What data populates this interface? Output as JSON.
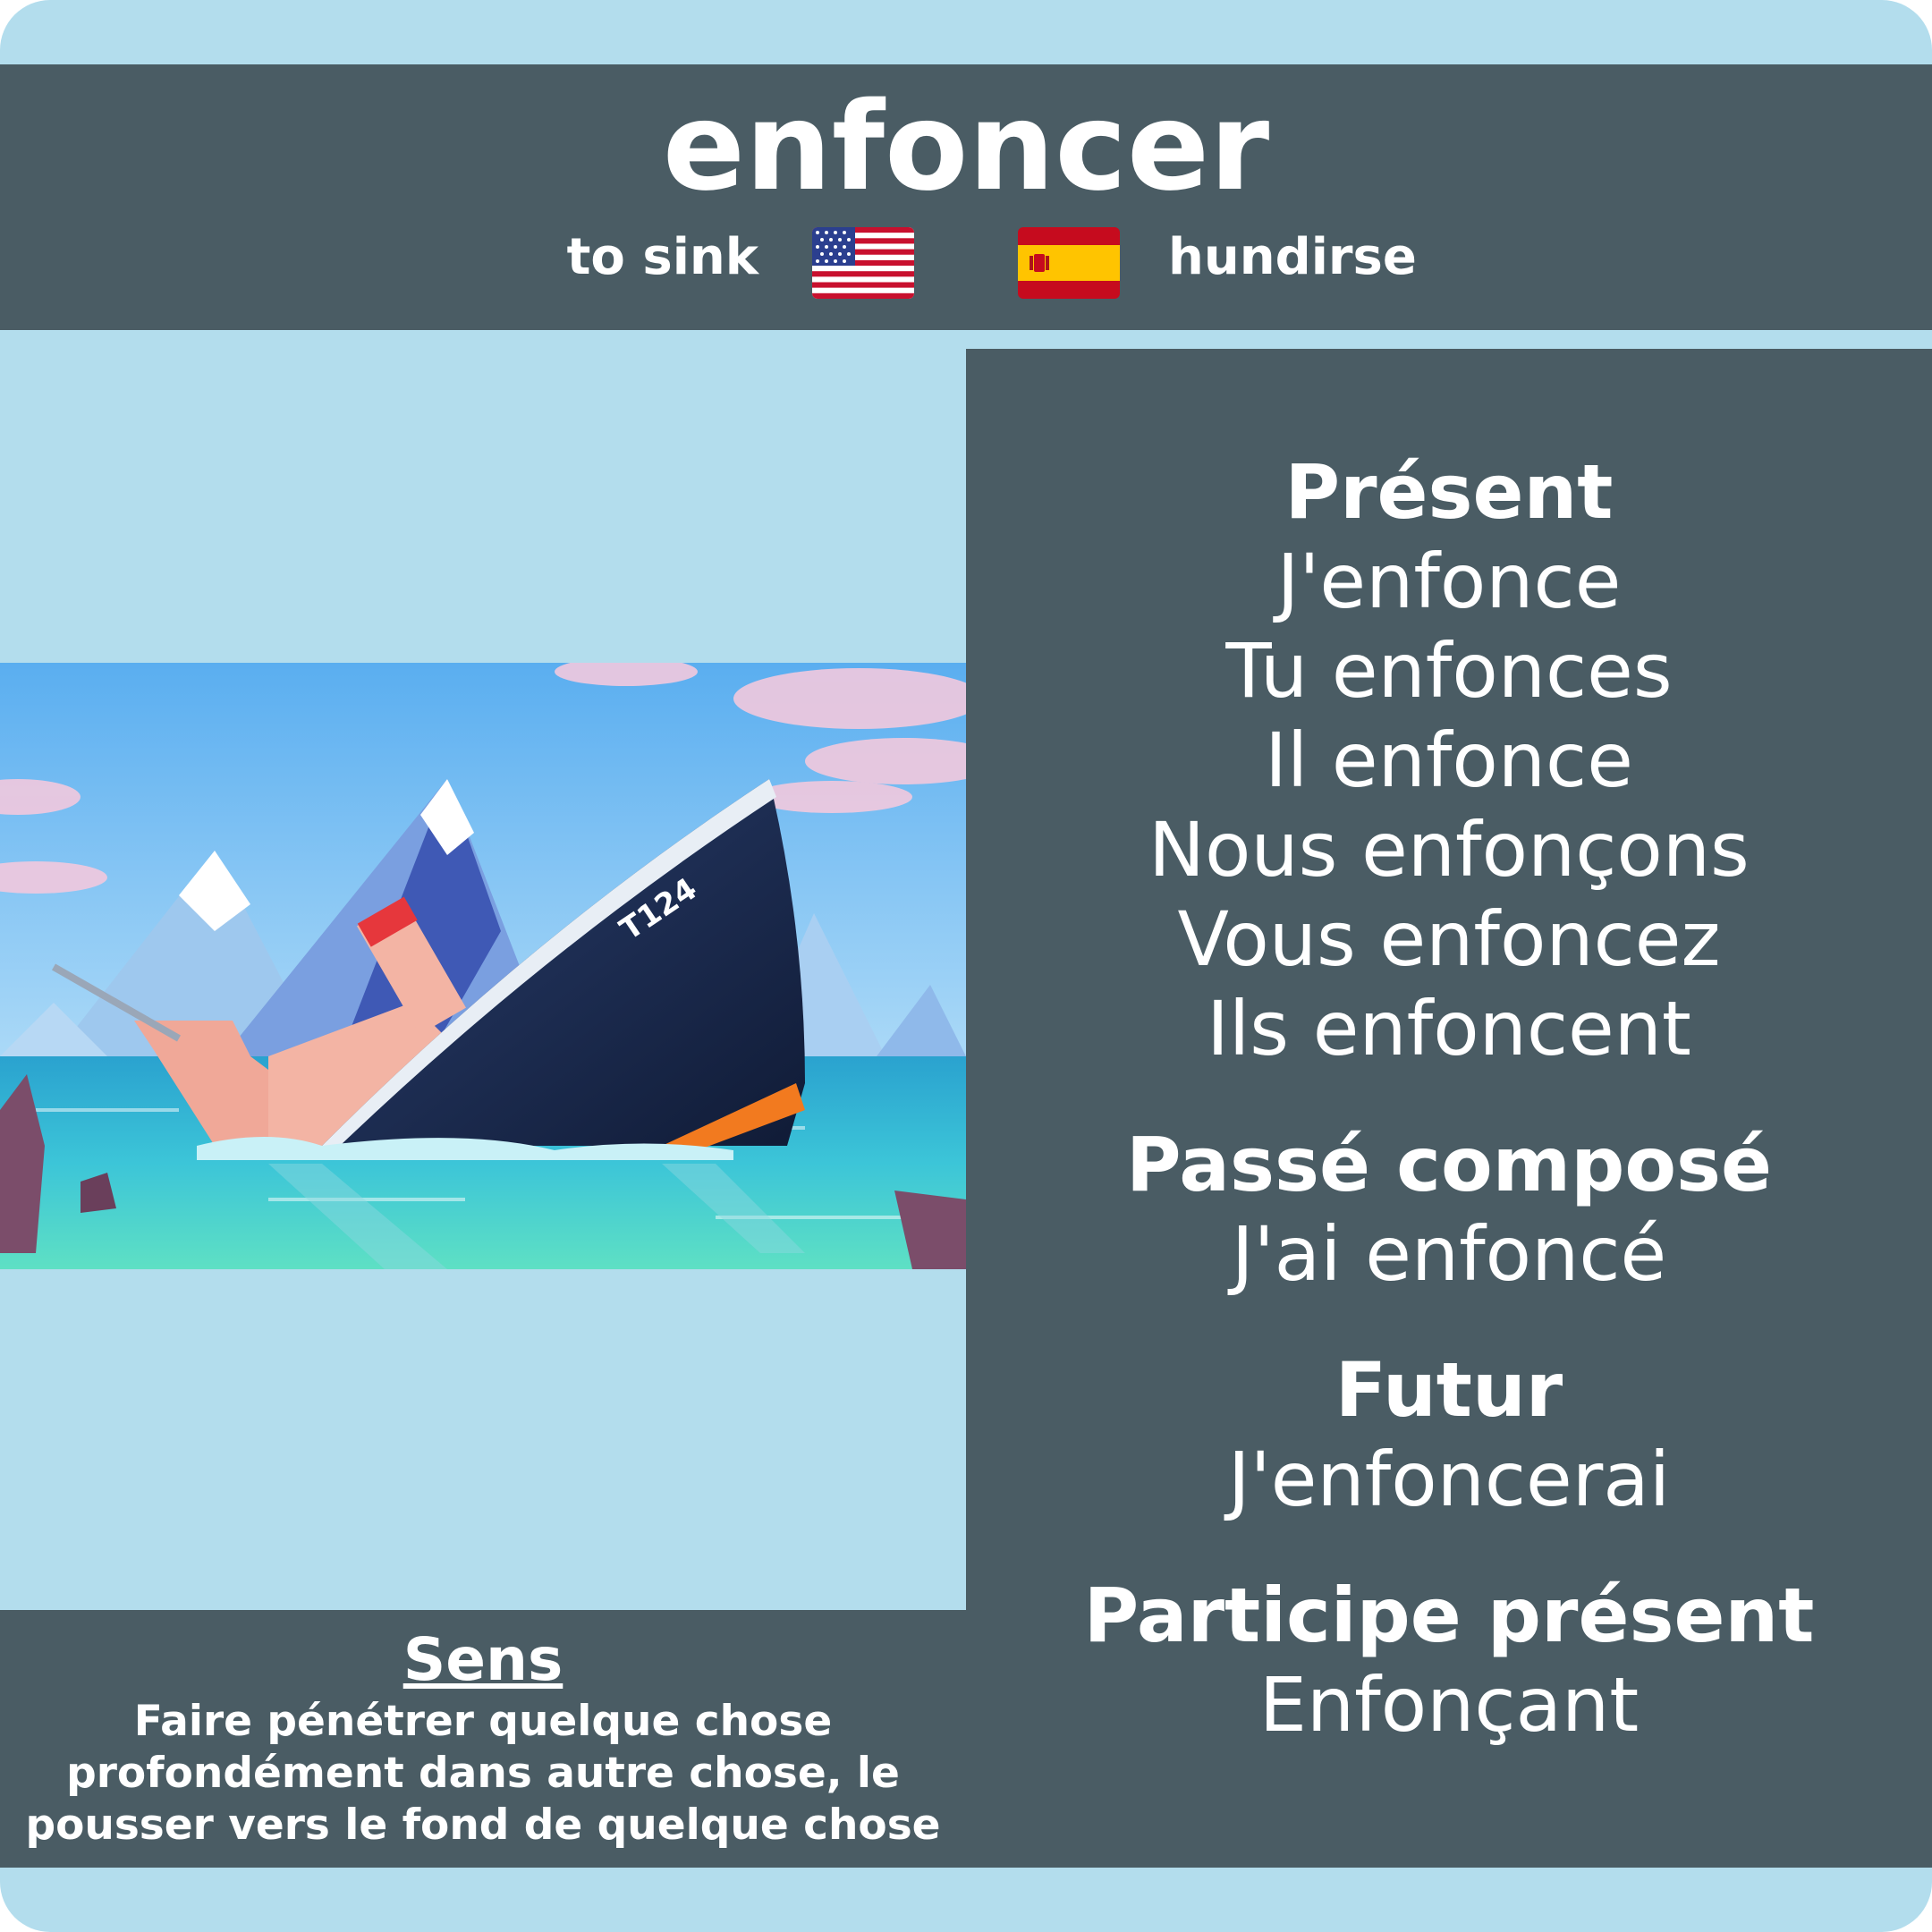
{
  "verb": "enfoncer",
  "translations": {
    "en": {
      "text": "to sink",
      "flag_icon": "us-flag-icon"
    },
    "es": {
      "text": "hundirse",
      "flag_icon": "spain-flag-icon"
    }
  },
  "illustration": {
    "ship_label": "T124"
  },
  "conjugation": {
    "present": {
      "label": "Présent",
      "forms": [
        "J'enfonce",
        "Tu enfonces",
        "Il enfonce",
        "Nous enfonçons",
        "Vous enfoncez",
        "Ils enfoncent"
      ]
    },
    "passe_compose": {
      "label": "Passé composé",
      "form": "J'ai enfoncé"
    },
    "futur": {
      "label": "Futur",
      "form": "J'enfoncerai"
    },
    "participe_present": {
      "label": "Participe présent",
      "form": "Enfonçant"
    }
  },
  "sens": {
    "title": "Sens",
    "definition": "Faire pénétrer quelque chose profondément dans autre chose, le pousser vers le fond de quelque chose"
  },
  "colors": {
    "panel": "#4a5c64",
    "background": "#b3dded",
    "text": "#ffffff"
  }
}
